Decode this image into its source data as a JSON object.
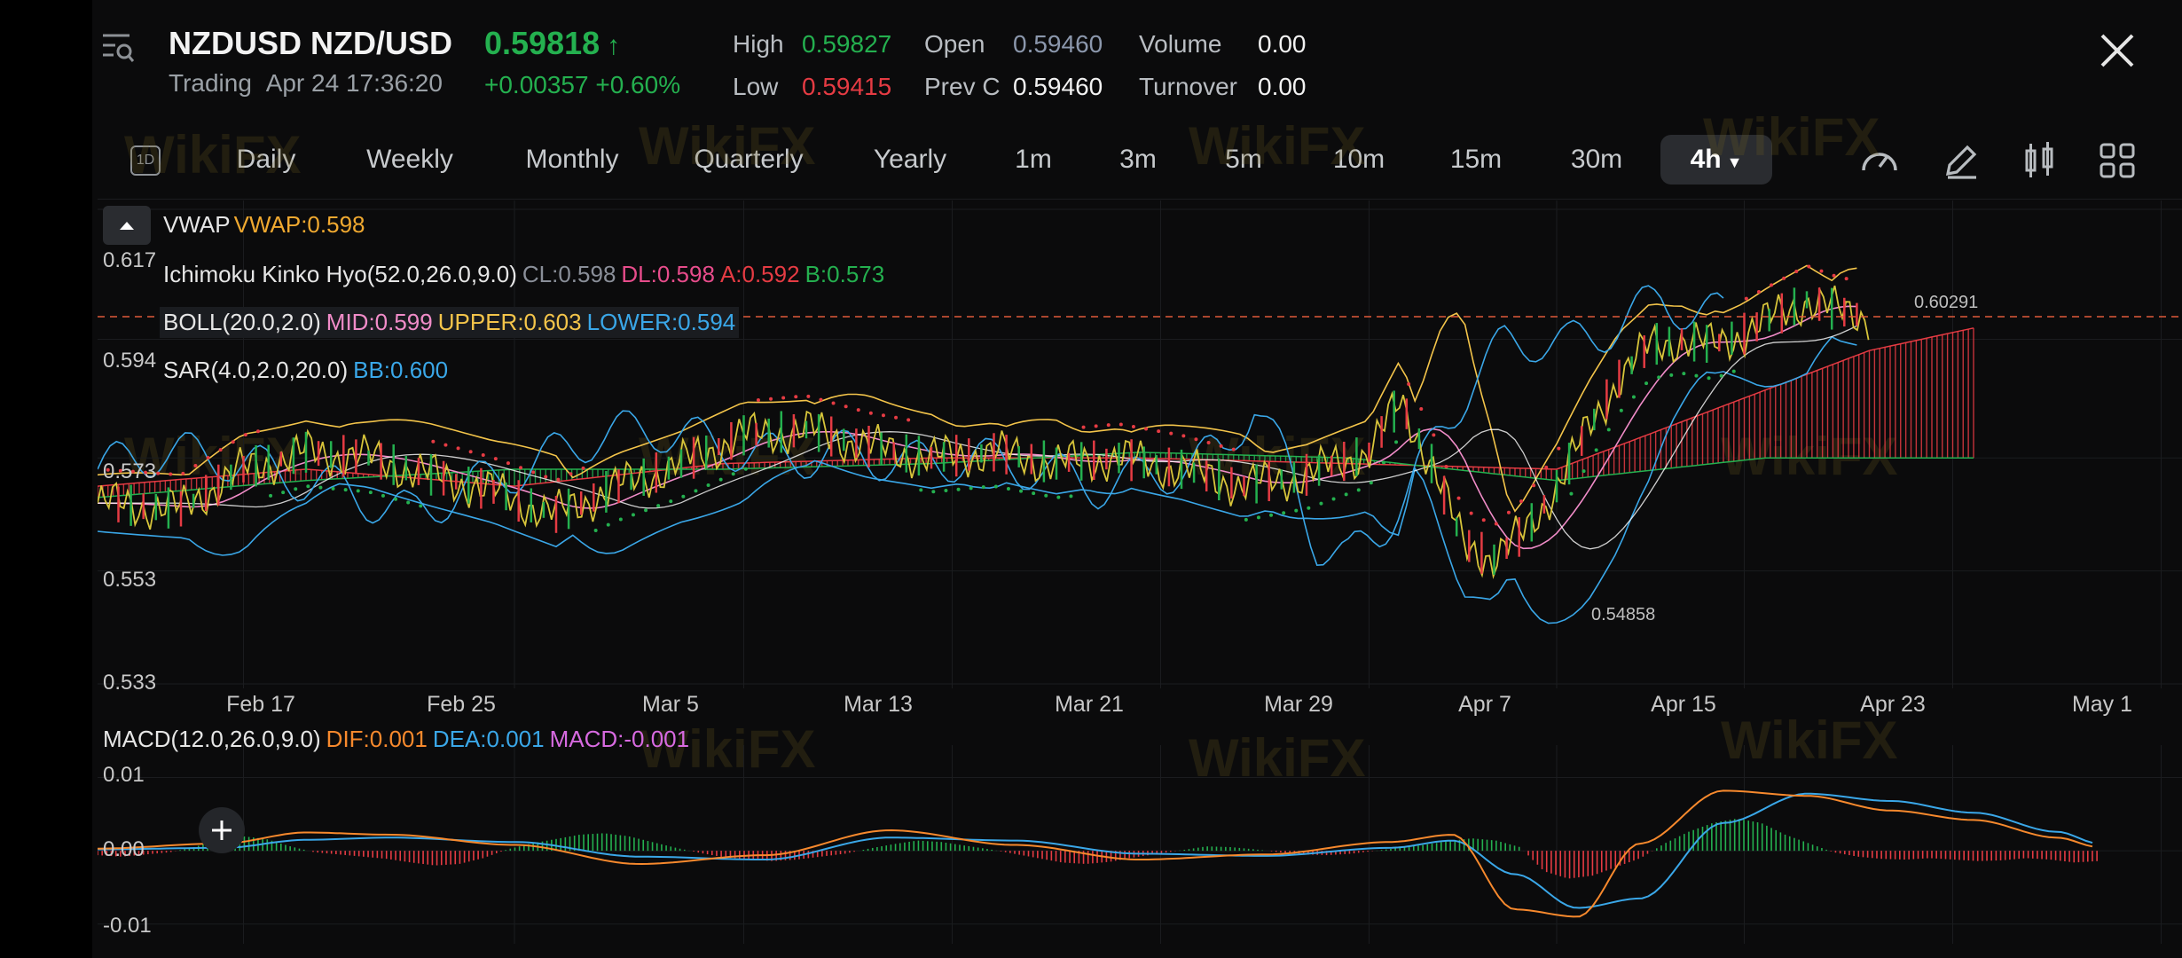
{
  "header": {
    "symbol": "NZDUSD NZD/USD",
    "price": "0.59818",
    "price_arrow": "↑",
    "trading_label": "Trading",
    "datetime": "Apr 24 17:36:20",
    "change": "+0.00357 +0.60%",
    "stats": {
      "high_label": "High",
      "high_value": "0.59827",
      "low_label": "Low",
      "low_value": "0.59415",
      "open_label": "Open",
      "open_value": "0.59460",
      "prevc_label": "Prev C",
      "prevc_value": "0.59460",
      "volume_label": "Volume",
      "volume_value": "0.00",
      "turnover_label": "Turnover",
      "turnover_value": "0.00"
    }
  },
  "timeframes": {
    "icon_label": "1D",
    "items": [
      "Daily",
      "Weekly",
      "Monthly",
      "Quarterly",
      "Yearly",
      "1m",
      "3m",
      "5m",
      "10m",
      "15m",
      "30m",
      "4h"
    ],
    "active": "4h"
  },
  "toolbar": {
    "icons": [
      "speedometer-icon",
      "pencil-icon",
      "candlestick-icon",
      "grid-icon"
    ]
  },
  "indicators": {
    "vwap": {
      "name": "VWAP",
      "value": "VWAP:0.598"
    },
    "ichimoku": {
      "name": "Ichimoku Kinko Hyo(52.0,26.0,9.0)",
      "cl": "CL:0.598",
      "dl": "DL:0.598",
      "a": "A:0.592",
      "b": "B:0.573"
    },
    "boll": {
      "name": "BOLL(20.0,2.0)",
      "mid": "MID:0.599",
      "upper": "UPPER:0.603",
      "lower": "LOWER:0.594"
    },
    "sar": {
      "name": "SAR(4.0,2.0,20.0)",
      "bb": "BB:0.600"
    }
  },
  "macd_legend": {
    "name": "MACD(12.0,26.0,9.0)",
    "dif": "DIF:0.001",
    "dea": "DEA:0.001",
    "macd": "MACD:-0.001"
  },
  "watermark": "WikiFX",
  "colors": {
    "up": "#24b04f",
    "down": "#e53b43",
    "vwap": "#f0a930",
    "cl": "#8a8f99",
    "dl": "#e74c8b",
    "a": "#e53b43",
    "b": "#24b04f",
    "mid": "#f08cc8",
    "upper": "#f3c44a",
    "lower": "#3aa7e8",
    "sar": "#3aa7e8",
    "dif": "#f7892d",
    "dea": "#3aa7e8",
    "macd": "#d76ae0",
    "price_line": "#e05a3a",
    "last_price": "#f24e2e"
  },
  "chart_data": [
    {
      "type": "line",
      "title": "NZDUSD NZD/USD",
      "x_ticks": [
        "Feb 17",
        "Feb 25",
        "Mar 5",
        "Mar 13",
        "Mar 21",
        "Mar 29",
        "Apr 7",
        "Apr 15",
        "Apr 23",
        "May 1"
      ],
      "y_ticks": [
        "0.617",
        "0.594",
        "0.573",
        "0.553",
        "0.533"
      ],
      "ylim": [
        0.533,
        0.617
      ],
      "annotations": {
        "high_label": "0.60291",
        "low_label": "0.54858"
      },
      "last_price": 0.598,
      "price_path": [
        [
          0,
          0.565
        ],
        [
          0.04,
          0.564
        ],
        [
          0.07,
          0.571
        ],
        [
          0.1,
          0.574
        ],
        [
          0.13,
          0.573
        ],
        [
          0.16,
          0.57
        ],
        [
          0.19,
          0.567
        ],
        [
          0.22,
          0.563
        ],
        [
          0.25,
          0.568
        ],
        [
          0.28,
          0.572
        ],
        [
          0.31,
          0.577
        ],
        [
          0.34,
          0.578
        ],
        [
          0.37,
          0.575
        ],
        [
          0.4,
          0.573
        ],
        [
          0.43,
          0.574
        ],
        [
          0.46,
          0.572
        ],
        [
          0.49,
          0.573
        ],
        [
          0.52,
          0.571
        ],
        [
          0.55,
          0.568
        ],
        [
          0.58,
          0.57
        ],
        [
          0.61,
          0.574
        ],
        [
          0.625,
          0.583
        ],
        [
          0.64,
          0.572
        ],
        [
          0.655,
          0.558
        ],
        [
          0.67,
          0.555
        ],
        [
          0.685,
          0.56
        ],
        [
          0.7,
          0.568
        ],
        [
          0.715,
          0.578
        ],
        [
          0.73,
          0.587
        ],
        [
          0.745,
          0.593
        ],
        [
          0.76,
          0.594
        ],
        [
          0.775,
          0.593
        ],
        [
          0.79,
          0.595
        ],
        [
          0.805,
          0.598
        ],
        [
          0.82,
          0.601
        ],
        [
          0.835,
          0.599
        ],
        [
          0.85,
          0.598
        ]
      ],
      "ichimoku_span_a_path": [
        [
          0,
          0.568
        ],
        [
          0.1,
          0.571
        ],
        [
          0.2,
          0.568
        ],
        [
          0.3,
          0.572
        ],
        [
          0.4,
          0.573
        ],
        [
          0.5,
          0.573
        ],
        [
          0.6,
          0.572
        ],
        [
          0.7,
          0.571
        ],
        [
          0.75,
          0.578
        ],
        [
          0.8,
          0.585
        ],
        [
          0.85,
          0.592
        ],
        [
          0.9,
          0.596
        ]
      ],
      "ichimoku_span_b_path": [
        [
          0,
          0.566
        ],
        [
          0.1,
          0.569
        ],
        [
          0.2,
          0.571
        ],
        [
          0.3,
          0.571
        ],
        [
          0.4,
          0.572
        ],
        [
          0.5,
          0.574
        ],
        [
          0.6,
          0.573
        ],
        [
          0.7,
          0.569
        ],
        [
          0.75,
          0.571
        ],
        [
          0.8,
          0.573
        ],
        [
          0.85,
          0.573
        ],
        [
          0.9,
          0.573
        ]
      ]
    },
    {
      "type": "bar",
      "title": "MACD(12.0,26.0,9.0)",
      "y_ticks": [
        "0.01",
        "0.00",
        "-0.01"
      ],
      "ylim": [
        -0.011,
        0.012
      ],
      "histogram": [
        -0.0006,
        -0.0008,
        -0.0005,
        -0.0002,
        0.0005,
        0.0015,
        0.002,
        0.0016,
        0.0006,
        -0.0002,
        -0.0005,
        -0.0008,
        -0.0011,
        -0.0016,
        -0.002,
        -0.0018,
        -0.001,
        0.0002,
        0.001,
        0.0016,
        0.0022,
        0.0024,
        0.002,
        0.0012,
        0.0004,
        -0.0003,
        -0.0009,
        -0.0012,
        -0.0014,
        -0.0012,
        -0.0008,
        -0.0004,
        0.0003,
        0.0009,
        0.0014,
        0.0012,
        0.0007,
        0.0002,
        -0.0004,
        -0.001,
        -0.0016,
        -0.0018,
        -0.0015,
        -0.0009,
        -0.0004,
        0.0001,
        0.0006,
        0.0005,
        0.0002,
        -0.0002,
        -0.0005,
        -0.0006,
        -0.0004,
        0.0,
        0.0004,
        0.0008,
        0.0013,
        0.0017,
        0.0014,
        0.0005,
        -0.0028,
        -0.0038,
        -0.0034,
        -0.0022,
        -0.001,
        0.001,
        0.0026,
        0.0038,
        0.0044,
        0.0038,
        0.0022,
        0.001,
        -0.0002,
        -0.0008,
        -0.0011,
        -0.0012,
        -0.001,
        -0.0012,
        -0.0014,
        -0.0013,
        -0.001,
        -0.0012,
        -0.0016,
        -0.0014
      ],
      "dif_path": [
        [
          0,
          0.0003
        ],
        [
          0.06,
          0.001
        ],
        [
          0.1,
          0.0025
        ],
        [
          0.14,
          0.0022
        ],
        [
          0.2,
          0.0008
        ],
        [
          0.26,
          -0.0018
        ],
        [
          0.32,
          -0.0006
        ],
        [
          0.38,
          0.0028
        ],
        [
          0.44,
          0.0008
        ],
        [
          0.5,
          -0.0012
        ],
        [
          0.56,
          -0.0005
        ],
        [
          0.62,
          0.0012
        ],
        [
          0.65,
          0.0022
        ],
        [
          0.68,
          -0.008
        ],
        [
          0.71,
          -0.009
        ],
        [
          0.74,
          0.001
        ],
        [
          0.78,
          0.0082
        ],
        [
          0.82,
          0.0075
        ],
        [
          0.86,
          0.0055
        ],
        [
          0.9,
          0.0042
        ],
        [
          0.94,
          0.0018
        ],
        [
          0.96,
          0.0005
        ]
      ],
      "dea_path": [
        [
          0,
          0.0002
        ],
        [
          0.06,
          0.0004
        ],
        [
          0.1,
          0.0015
        ],
        [
          0.14,
          0.0018
        ],
        [
          0.2,
          0.0012
        ],
        [
          0.26,
          -0.0008
        ],
        [
          0.32,
          -0.0012
        ],
        [
          0.38,
          0.0018
        ],
        [
          0.44,
          0.0014
        ],
        [
          0.5,
          -0.0004
        ],
        [
          0.56,
          -0.0007
        ],
        [
          0.62,
          0.0004
        ],
        [
          0.65,
          0.0014
        ],
        [
          0.68,
          -0.0032
        ],
        [
          0.71,
          -0.0078
        ],
        [
          0.74,
          -0.0065
        ],
        [
          0.78,
          0.0038
        ],
        [
          0.82,
          0.0078
        ],
        [
          0.86,
          0.0068
        ],
        [
          0.9,
          0.0052
        ],
        [
          0.94,
          0.0026
        ],
        [
          0.96,
          0.001
        ]
      ]
    }
  ]
}
